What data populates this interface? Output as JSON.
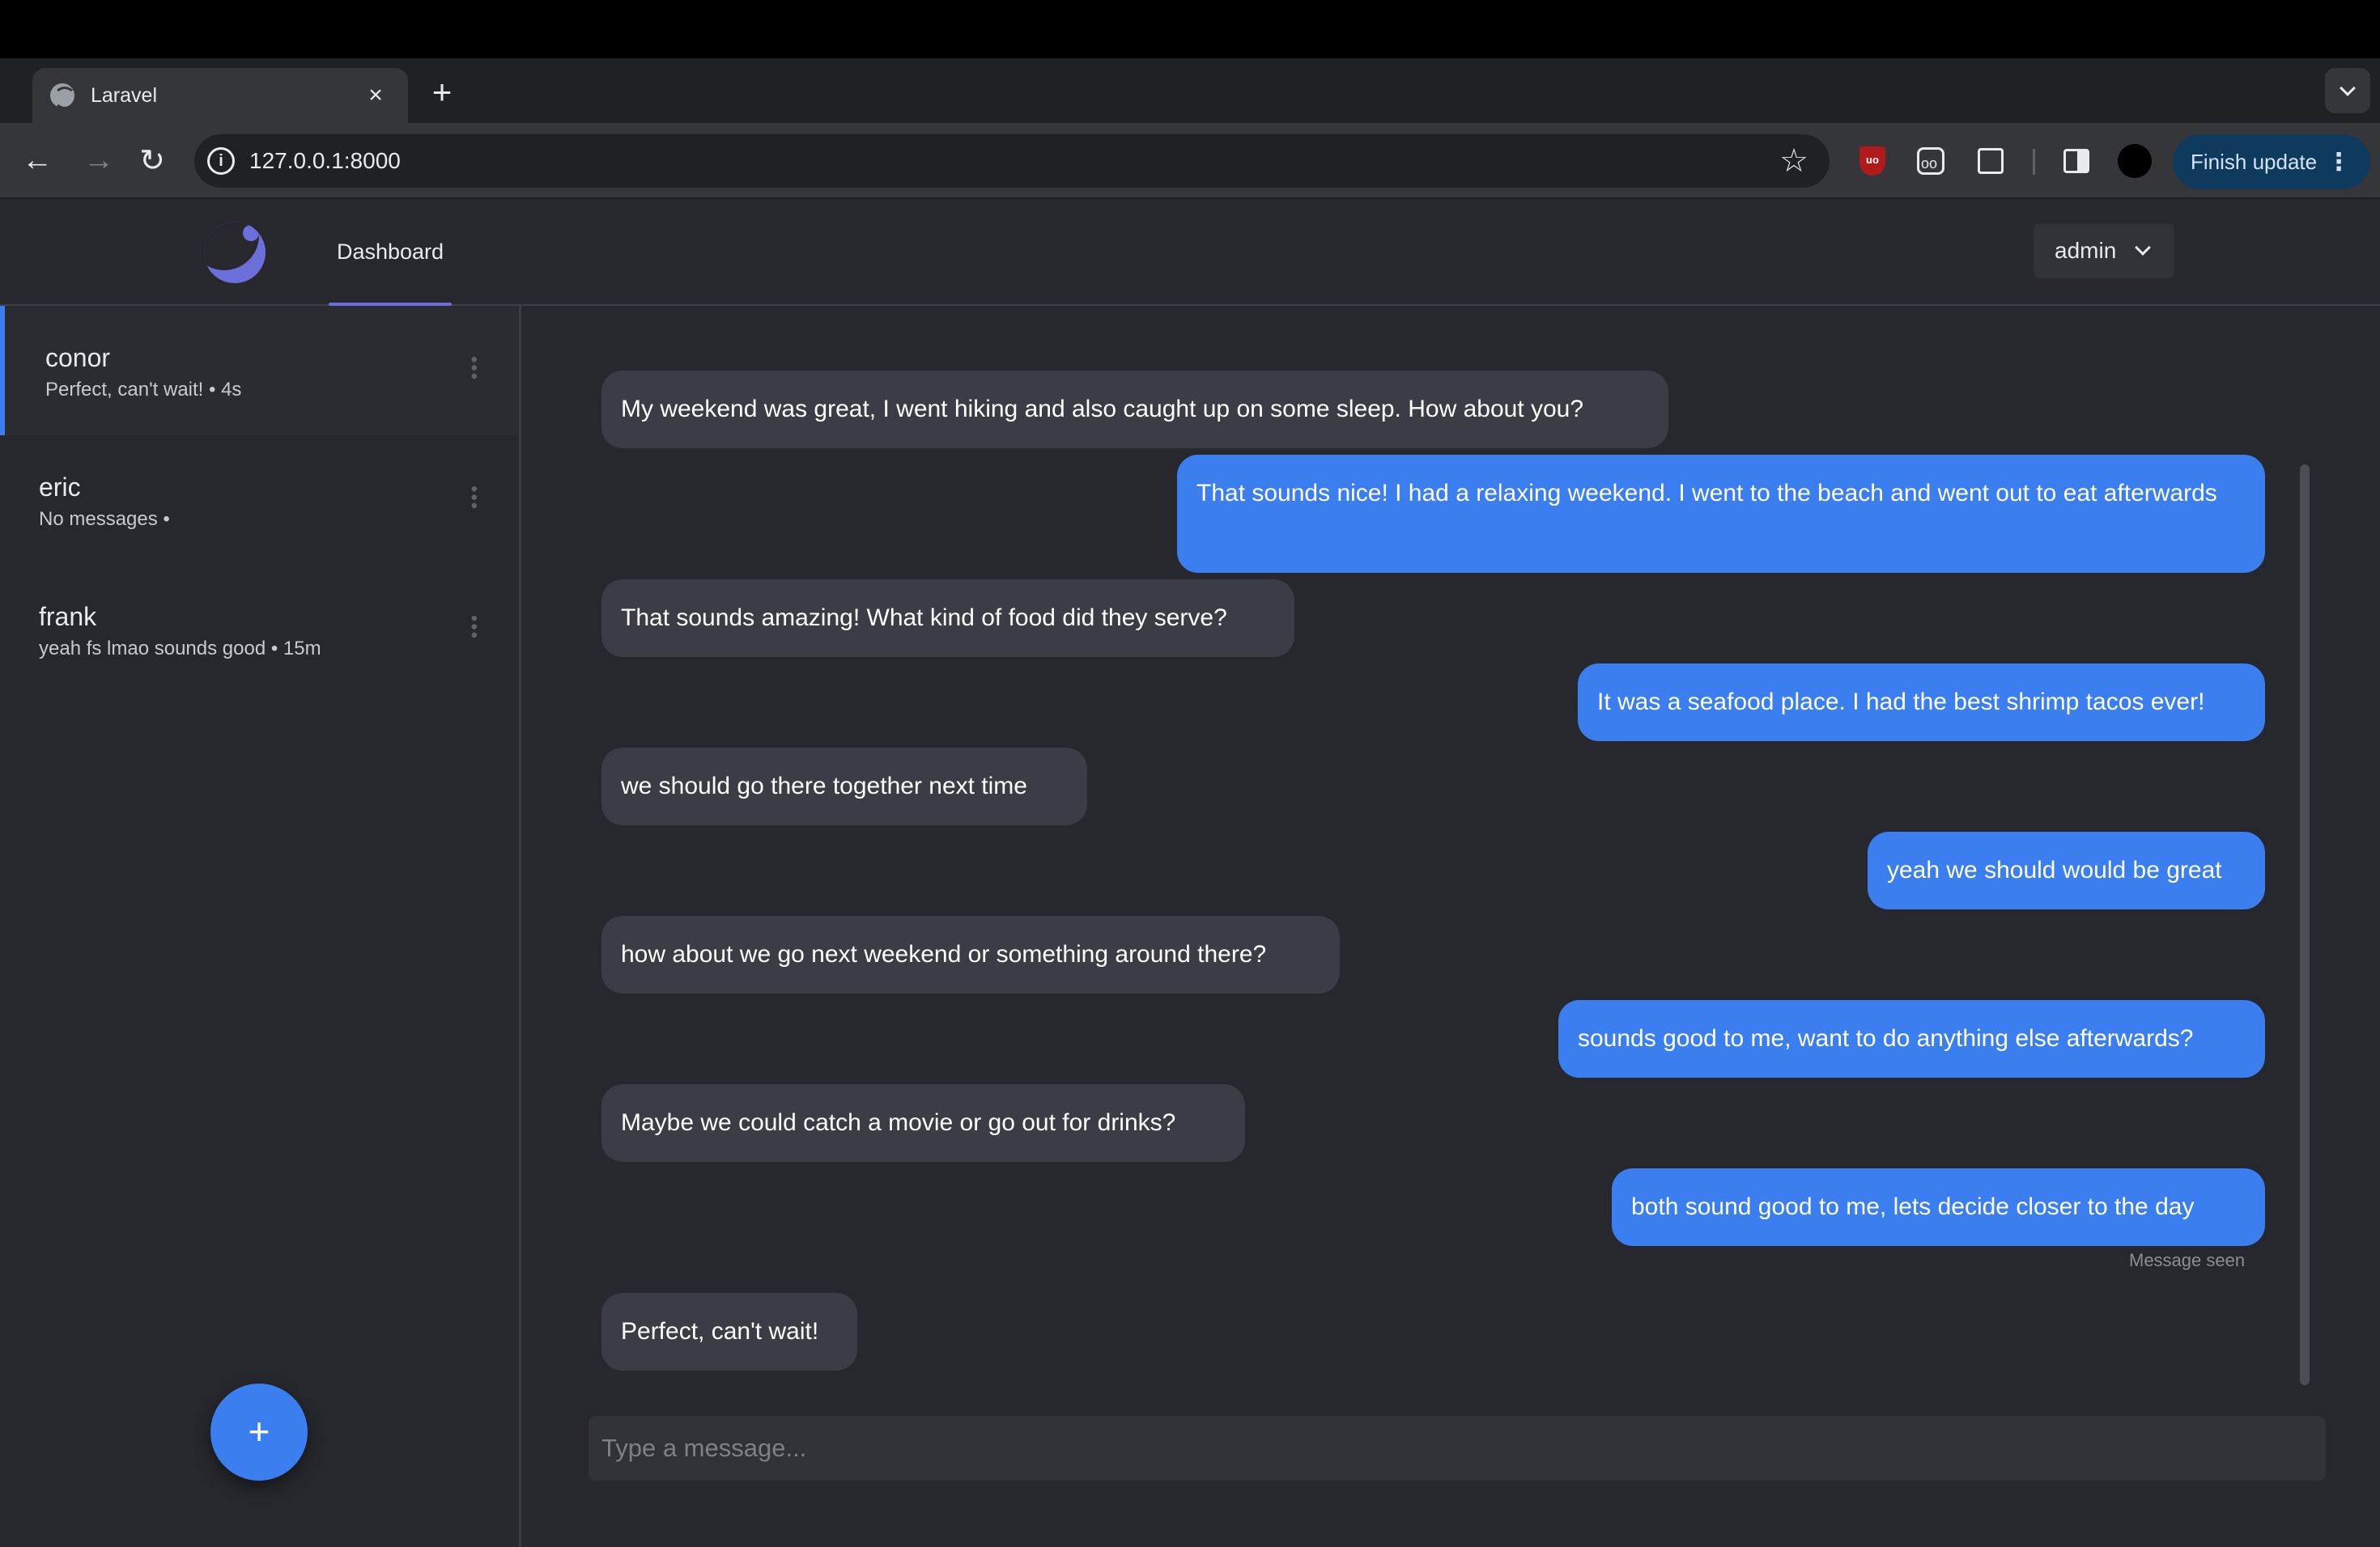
{
  "browser": {
    "tab_title": "Laravel",
    "tab_close": "×",
    "new_tab": "+",
    "url": "127.0.0.1:8000",
    "finish_update": "Finish update"
  },
  "app": {
    "nav_dashboard": "Dashboard",
    "user": "admin"
  },
  "conversations": [
    {
      "name": "conor",
      "preview": "Perfect, can't wait! • 4s",
      "active": true
    },
    {
      "name": "eric",
      "preview": "No messages •",
      "active": false
    },
    {
      "name": "frank",
      "preview": "yeah fs lmao sounds good • 15m",
      "active": false
    }
  ],
  "fab_label": "+",
  "messages": [
    {
      "from": "them",
      "text": "My weekend was great, I went hiking and also caught up on some sleep. How about you?"
    },
    {
      "from": "me",
      "text": "That sounds nice! I had a relaxing weekend. I went to the beach and went out to eat afterwards"
    },
    {
      "from": "them",
      "text": "That sounds amazing! What kind of food did they serve?"
    },
    {
      "from": "me",
      "text": "It was a seafood place. I had the best shrimp tacos ever!"
    },
    {
      "from": "them",
      "text": "we should go there together next time"
    },
    {
      "from": "me",
      "text": "yeah we should would be great"
    },
    {
      "from": "them",
      "text": "how about we go next weekend or something around there?"
    },
    {
      "from": "me",
      "text": "sounds good to me, want to do anything else afterwards?"
    },
    {
      "from": "them",
      "text": "Maybe we could catch a movie or go out for drinks?"
    },
    {
      "from": "me",
      "text": "both sound good to me, lets decide closer to the day"
    },
    {
      "from": "them",
      "text": "Perfect, can't wait!"
    }
  ],
  "seen_label": "Message seen",
  "composer": {
    "placeholder": "Type a message..."
  },
  "colors": {
    "accent": "#3a7ef0",
    "incoming": "#3a3d45",
    "brand": "#6c6fd9"
  }
}
